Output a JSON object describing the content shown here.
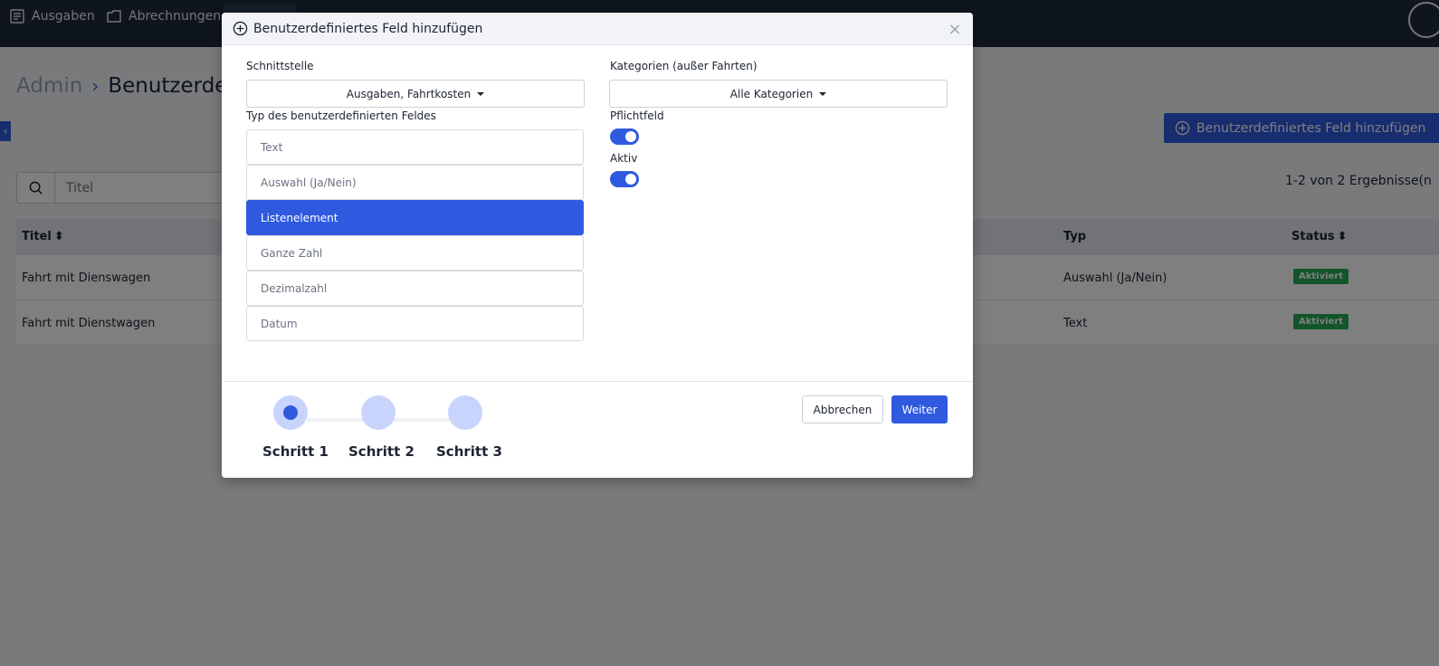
{
  "topbar": {
    "items": [
      {
        "label": "Ausgaben",
        "icon": "receipt-icon"
      },
      {
        "label": "Abrechnungen",
        "icon": "folder-icon"
      }
    ]
  },
  "breadcrumb": {
    "root": "Admin",
    "current": "Benutzerdef"
  },
  "page": {
    "add_button_label": "Benutzerdefiniertes Feld hinzufügen",
    "search_placeholder": "Titel",
    "results_text": "1-2 von 2 Ergebnisse(n"
  },
  "table": {
    "columns": {
      "title": "Titel",
      "type": "Typ",
      "status": "Status"
    },
    "rows": [
      {
        "title": "Fahrt mit Dienswagen",
        "type": "Auswahl (Ja/Nein)",
        "status": "Aktiviert"
      },
      {
        "title": "Fahrt mit Dienstwagen",
        "type": "Text",
        "status": "Aktiviert"
      }
    ]
  },
  "modal": {
    "title": "Benutzerdefiniertes Feld hinzufügen",
    "interface_label": "Schnittstelle",
    "interface_value": "Ausgaben, Fahrtkosten",
    "categories_label": "Kategorien (außer Fahrten)",
    "categories_value": "Alle Kategorien",
    "type_label": "Typ des benutzerdefinierten Feldes",
    "types": [
      "Text",
      "Auswahl (Ja/Nein)",
      "Listenelement",
      "Ganze Zahl",
      "Dezimalzahl",
      "Datum"
    ],
    "selected_type": "Listenelement",
    "required_label": "Pflichtfeld",
    "required_on": true,
    "active_label": "Aktiv",
    "active_on": true,
    "steps": [
      "Schritt 1",
      "Schritt 2",
      "Schritt 3"
    ],
    "current_step": 1,
    "cancel_label": "Abbrechen",
    "next_label": "Weiter"
  },
  "colors": {
    "primary": "#2f5ae0",
    "topbar": "#1e2a3b",
    "success": "#27a857"
  }
}
